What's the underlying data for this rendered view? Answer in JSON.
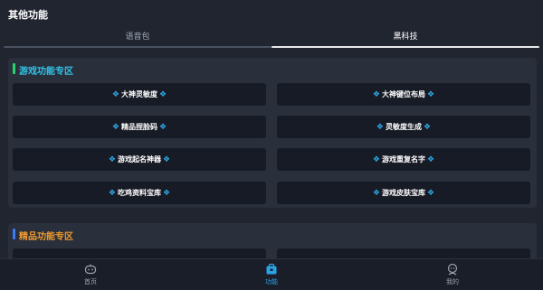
{
  "header": {
    "title": "其他功能"
  },
  "tabs": [
    {
      "label": "语音包",
      "active": false
    },
    {
      "label": "黑科技",
      "active": true
    }
  ],
  "sections": [
    {
      "title": "游戏功能专区",
      "accent": "#31c4e8",
      "bar_color": "#27d36b",
      "items": [
        "大神灵敏度",
        "大神键位布局",
        "精品捏脸码",
        "灵敏度生成",
        "游戏起名神器",
        "游戏重复名字",
        "吃鸡资料宝库",
        "游戏皮肤宝库"
      ]
    },
    {
      "title": "精品功能专区",
      "accent": "#f19a2e",
      "bar_color": "#3d7bf5",
      "items": []
    }
  ],
  "bottom_nav": [
    {
      "label": "首页",
      "icon": "gamepad-icon"
    },
    {
      "label": "功能",
      "icon": "toolbox-icon",
      "active": true
    },
    {
      "label": "我的",
      "icon": "user-icon"
    }
  ],
  "diamond_glyph": "❖"
}
